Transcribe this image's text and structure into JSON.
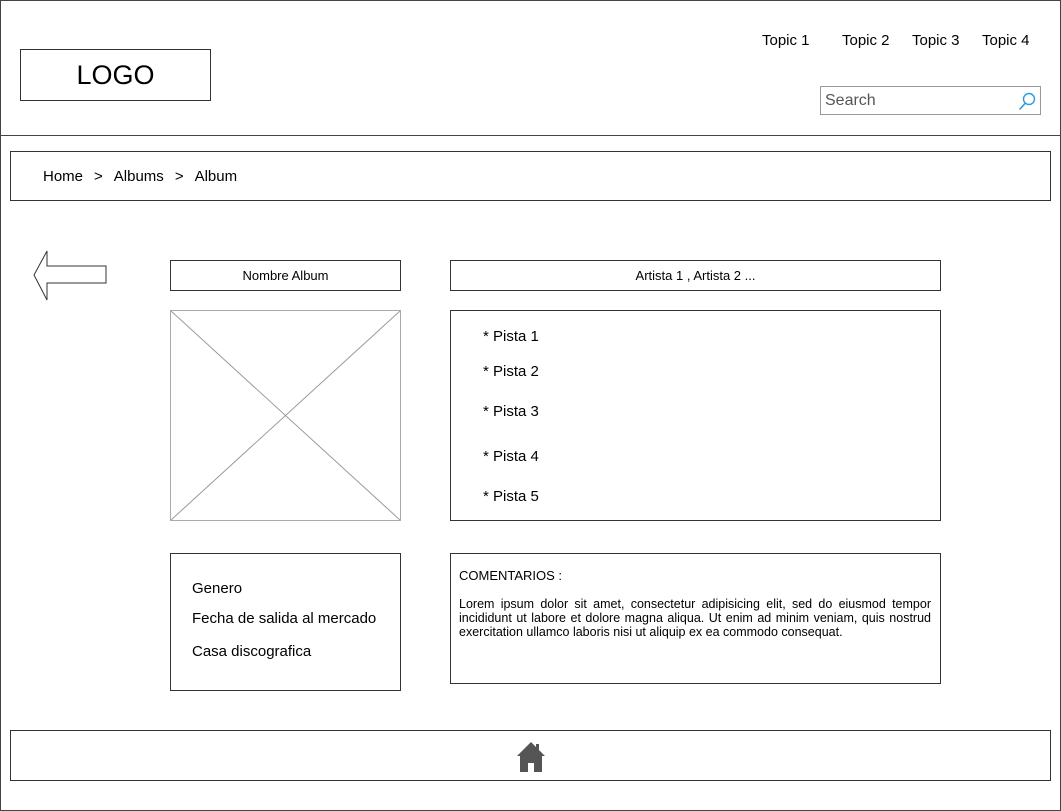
{
  "header": {
    "logo": "LOGO",
    "nav": [
      "Topic 1",
      "Topic 2",
      "Topic 3",
      "Topic 4"
    ],
    "search": {
      "placeholder": "Search",
      "icon": "search-icon"
    }
  },
  "breadcrumb": {
    "items": [
      "Home",
      "Albums",
      "Album"
    ],
    "separator": ">"
  },
  "back": {
    "icon": "back-arrow-icon"
  },
  "album": {
    "name": "Nombre Album",
    "artists": "Artista 1 , Artista 2 ...",
    "cover_icon": "image-placeholder-icon"
  },
  "tracks": [
    "* Pista 1",
    "* Pista 2",
    "* Pista 3",
    "* Pista 4",
    "* Pista 5"
  ],
  "info": [
    "Genero",
    "Fecha de salida al mercado",
    "Casa discografica"
  ],
  "comments": {
    "label": "COMENTARIOS :",
    "text": "Lorem ipsum dolor sit amet, consectetur adipisicing elit, sed do eiusmod tempor incididunt ut labore et dolore magna aliqua. Ut enim ad minim veniam, quis nostrud exercitation ullamco laboris nisi ut aliquip ex ea commodo consequat."
  },
  "footer": {
    "icon": "home-icon"
  }
}
